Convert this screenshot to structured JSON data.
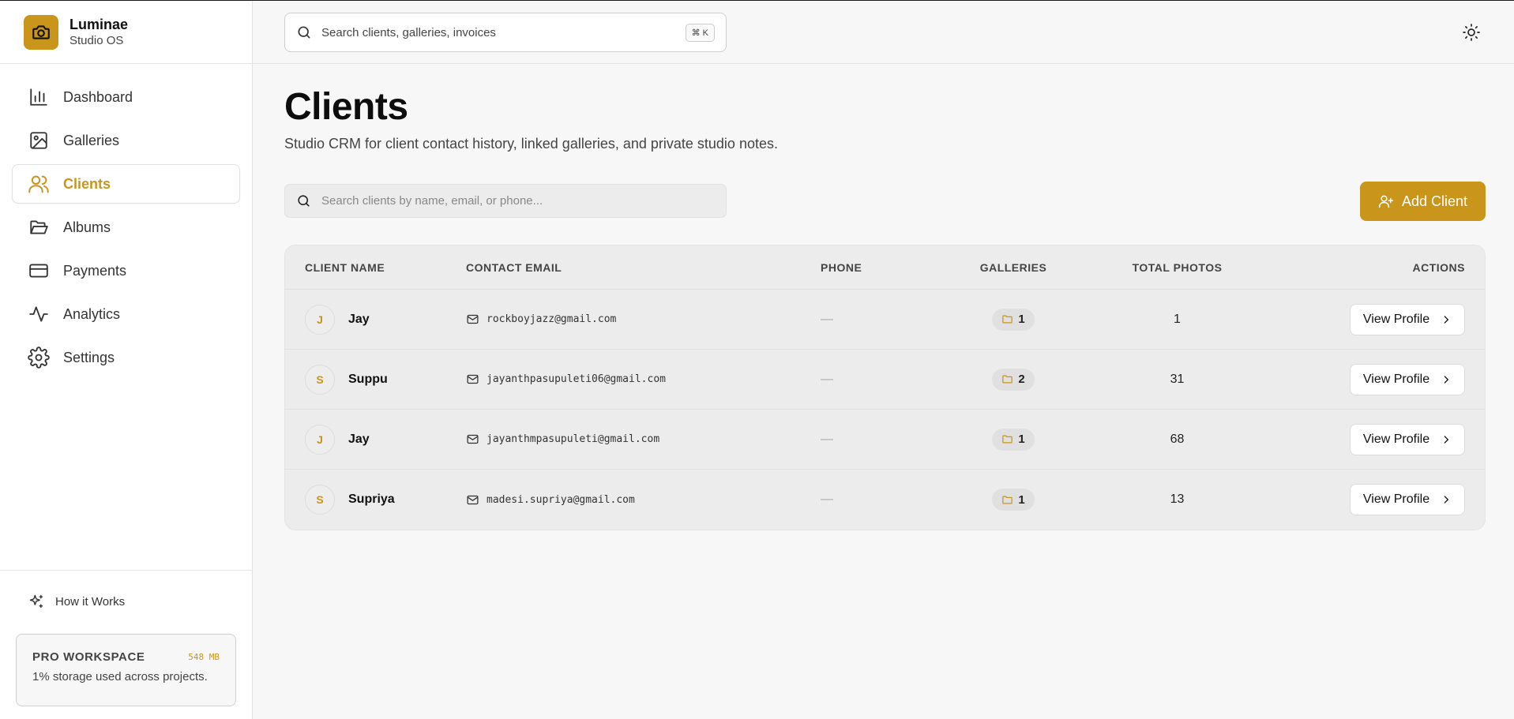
{
  "brand": {
    "name": "Luminae",
    "subtitle": "Studio OS"
  },
  "sidebar": {
    "items": [
      {
        "label": "Dashboard",
        "icon": "bar-chart-icon",
        "active": false
      },
      {
        "label": "Galleries",
        "icon": "image-icon",
        "active": false
      },
      {
        "label": "Clients",
        "icon": "users-icon",
        "active": true
      },
      {
        "label": "Albums",
        "icon": "folder-open-icon",
        "active": false
      },
      {
        "label": "Payments",
        "icon": "credit-card-icon",
        "active": false
      },
      {
        "label": "Analytics",
        "icon": "activity-icon",
        "active": false
      },
      {
        "label": "Settings",
        "icon": "gear-icon",
        "active": false
      }
    ],
    "how_it_works": "How it Works",
    "workspace": {
      "title": "PRO WORKSPACE",
      "size": "548 MB",
      "description": "1% storage used across projects."
    }
  },
  "topbar": {
    "search_placeholder": "Search clients, galleries, invoices",
    "shortcut": "⌘ K"
  },
  "page": {
    "title": "Clients",
    "subtitle": "Studio CRM for client contact history, linked galleries, and private studio notes.",
    "search_placeholder": "Search clients by name, email, or phone...",
    "add_button": "Add Client"
  },
  "table": {
    "headers": {
      "name": "CLIENT NAME",
      "email": "CONTACT EMAIL",
      "phone": "PHONE",
      "galleries": "GALLERIES",
      "photos": "TOTAL PHOTOS",
      "actions": "ACTIONS"
    },
    "rows": [
      {
        "initial": "J",
        "name": "Jay",
        "email": "rockboyjazz@gmail.com",
        "phone": "—",
        "galleries": "1",
        "photos": "1",
        "action": "View Profile"
      },
      {
        "initial": "S",
        "name": "Suppu",
        "email": "jayanthpasupuleti06@gmail.com",
        "phone": "—",
        "galleries": "2",
        "photos": "31",
        "action": "View Profile"
      },
      {
        "initial": "J",
        "name": "Jay",
        "email": "jayanthmpasupuleti@gmail.com",
        "phone": "—",
        "galleries": "1",
        "photos": "68",
        "action": "View Profile"
      },
      {
        "initial": "S",
        "name": "Supriya",
        "email": "madesi.supriya@gmail.com",
        "phone": "—",
        "galleries": "1",
        "photos": "13",
        "action": "View Profile"
      }
    ]
  },
  "colors": {
    "accent": "#c9951a",
    "background": "#f7f7f7"
  }
}
